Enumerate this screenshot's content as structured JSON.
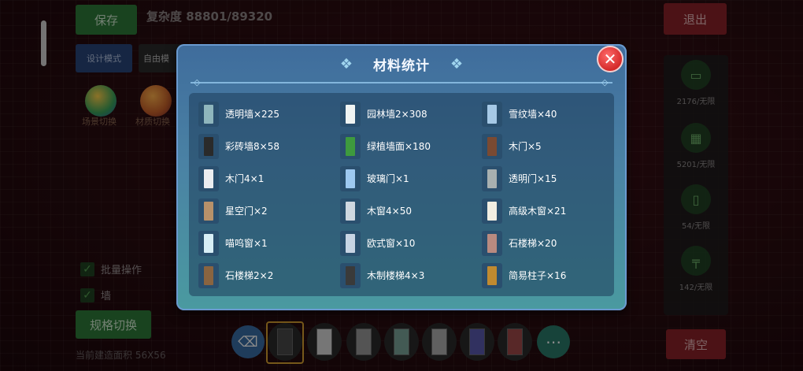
{
  "background": {
    "save_label": "保存",
    "complexity_text": "复杂度 88801/89320",
    "design_mode_label": "设计模式",
    "free_mode_label": "自由模",
    "circle_labels": [
      "场景切换",
      "材质切换"
    ],
    "batch_label": "批量操作",
    "wall_label": "墙",
    "spec_button_label": "规格切换",
    "area_text": "当前建造面积 56X56",
    "exit_label": "退出",
    "clear_label": "清空",
    "right_counts": [
      "2176/无限",
      "5201/无限",
      "54/无限",
      "142/无限"
    ]
  },
  "modal": {
    "title": "材料统计",
    "close_icon": "close-icon",
    "items": [
      {
        "label": "透明墙×225",
        "color": "#8fb6bd"
      },
      {
        "label": "园林墙2×308",
        "color": "#f0f4f2"
      },
      {
        "label": "雪纹墙×40",
        "color": "#a6c9e6"
      },
      {
        "label": "彩砖墙8×58",
        "color": "#2a2a2a"
      },
      {
        "label": "绿植墙面×180",
        "color": "#3e9a3e"
      },
      {
        "label": "木门×5",
        "color": "#7a4a32"
      },
      {
        "label": "木门4×1",
        "color": "#ecedf0"
      },
      {
        "label": "玻璃门×1",
        "color": "#9ec8f0"
      },
      {
        "label": "透明门×15",
        "color": "#a8b0b0"
      },
      {
        "label": "星空门×2",
        "color": "#b8916a"
      },
      {
        "label": "木窗4×50",
        "color": "#cfd6e0"
      },
      {
        "label": "高级木窗×21",
        "color": "#f2eee2"
      },
      {
        "label": "喵呜窗×1",
        "color": "#d8eef6"
      },
      {
        "label": "欧式窗×10",
        "color": "#c8d4e4"
      },
      {
        "label": "石楼梯×20",
        "color": "#b88a80"
      },
      {
        "label": "石楼梯2×2",
        "color": "#8a6440"
      },
      {
        "label": "木制楼梯4×3",
        "color": "#3a3a3a"
      },
      {
        "label": "简易柱子×16",
        "color": "#c08a30"
      }
    ]
  }
}
